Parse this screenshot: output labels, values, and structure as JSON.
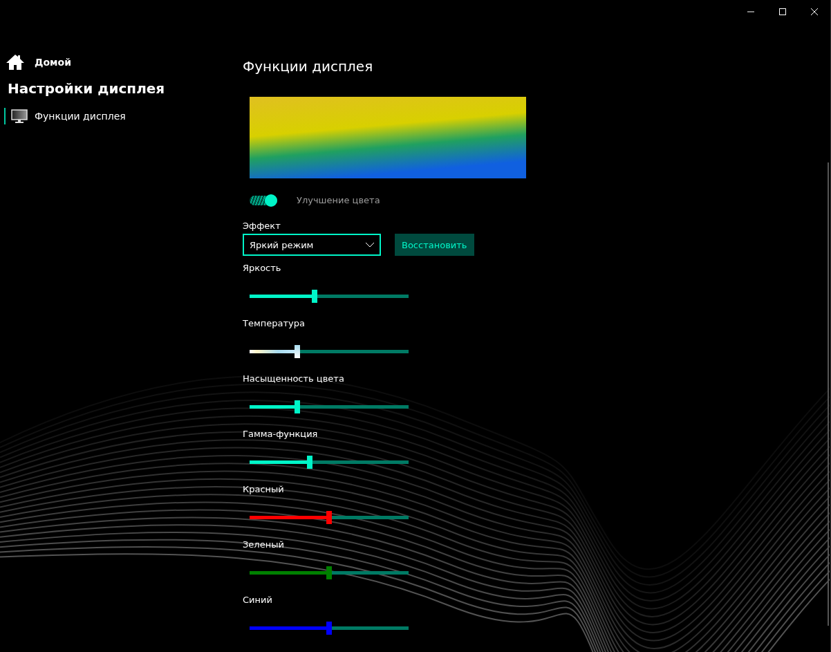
{
  "sidebar": {
    "home": "Домой",
    "title": "Настройки дисплея",
    "items": [
      {
        "label": "Функции дисплея",
        "selected": true
      }
    ]
  },
  "content": {
    "title": "Функции дисплея",
    "toggle": {
      "label": "Улучшение цвета",
      "on": true
    },
    "effect": {
      "label": "Эффект",
      "value": "Яркий режим"
    },
    "reset_button": "Восстановить",
    "sliders": [
      {
        "label": "Яркость",
        "kind": "solid",
        "color": "#00f5c8",
        "level": 0.41
      },
      {
        "label": "Температура",
        "kind": "gradient",
        "level": 0.3
      },
      {
        "label": "Насыщенность цвета",
        "kind": "solid",
        "color": "#00f5c8",
        "level": 0.3
      },
      {
        "label": "Гамма-функция",
        "kind": "solid",
        "color": "#00f5c8",
        "level": 0.38
      },
      {
        "label": "Красный",
        "kind": "solid",
        "color": "#ff0000",
        "level": 0.5
      },
      {
        "label": "Зеленый",
        "kind": "solid",
        "color": "#008000",
        "level": 0.5
      },
      {
        "label": "Синий",
        "kind": "solid",
        "color": "#0000ff",
        "level": 0.5
      }
    ]
  }
}
